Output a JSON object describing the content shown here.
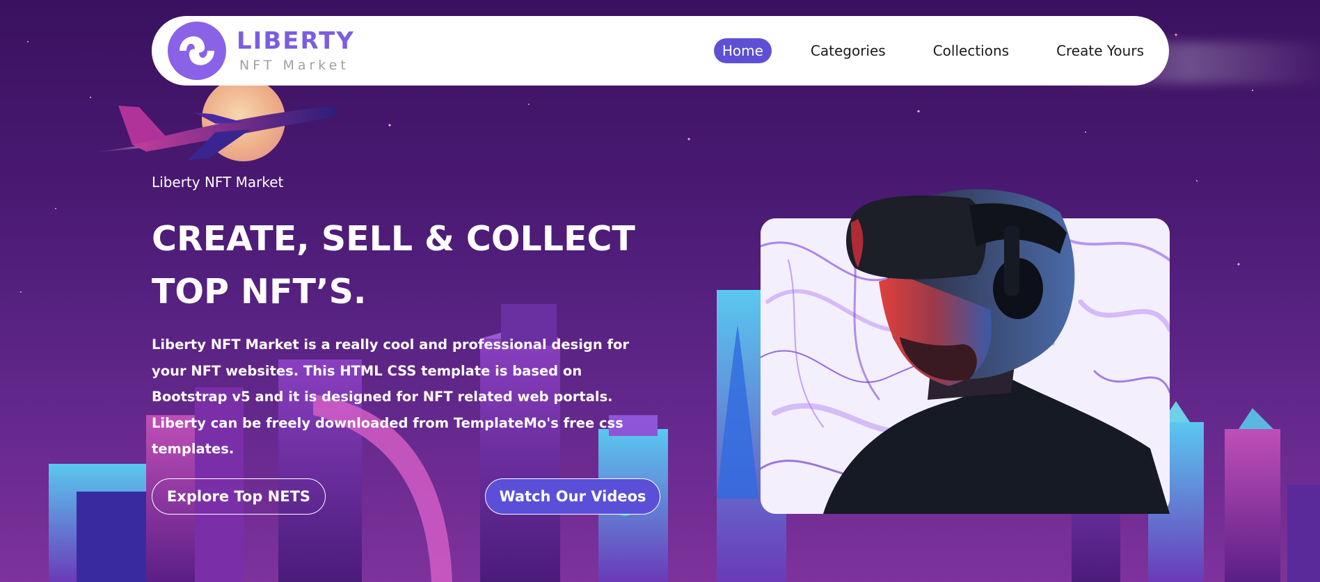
{
  "brand": {
    "name": "LIBERTY",
    "tagline": "NFT Market",
    "accent_color": "#7a5ee0"
  },
  "nav": {
    "items": [
      {
        "label": "Home",
        "active": true
      },
      {
        "label": "Categories",
        "active": false
      },
      {
        "label": "Collections",
        "active": false
      },
      {
        "label": "Create Yours",
        "active": false
      }
    ],
    "active_color": "#5e50d6"
  },
  "hero": {
    "eyebrow": "Liberty NFT Market",
    "headline_line1": "CREATE, SELL & COLLECT",
    "headline_line2": "TOP NFT’S.",
    "description": "Liberty NFT Market is a really cool and professional design for your NFT websites. This HTML CSS template is based on Bootstrap v5 and it is designed for NFT related web portals. Liberty can be freely downloaded from TemplateMo's free css templates.",
    "buttons": {
      "explore_label": "Explore Top NETS",
      "videos_label": "Watch Our Videos"
    },
    "image_icon": "vr-headset-person-icon"
  },
  "background": {
    "primary_color": "#4a1a73",
    "elements": [
      "airplane-icon",
      "moon-icon",
      "city-skyline"
    ]
  }
}
